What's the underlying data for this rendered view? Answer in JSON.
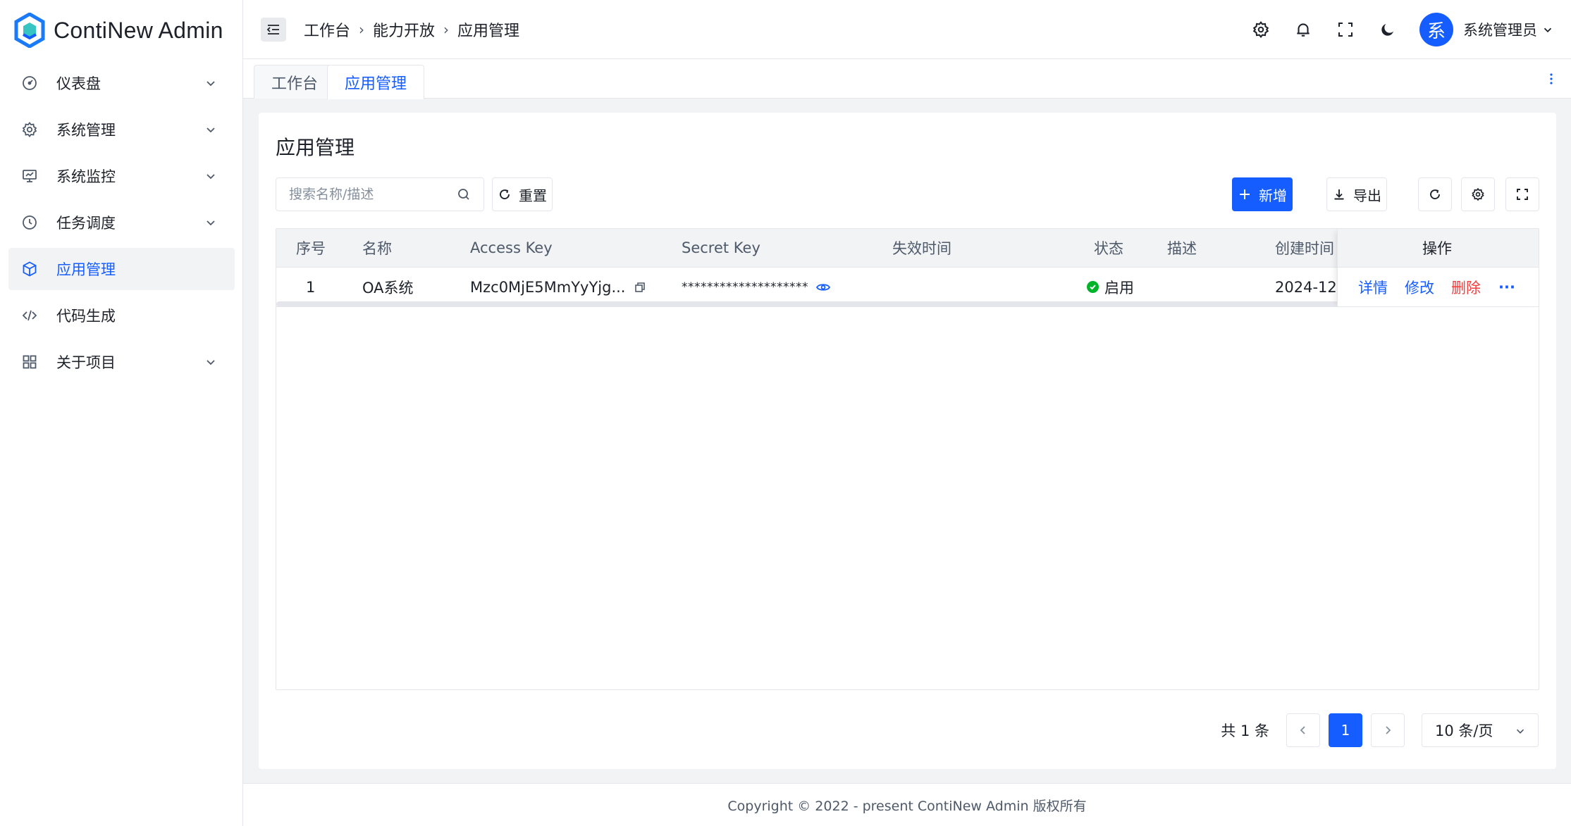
{
  "app": {
    "title": "ContiNew Admin"
  },
  "sidebar": {
    "items": [
      {
        "label": "仪表盘",
        "icon": "dashboard-icon",
        "expandable": true
      },
      {
        "label": "系统管理",
        "icon": "gear-icon",
        "expandable": true
      },
      {
        "label": "系统监控",
        "icon": "monitor-icon",
        "expandable": true
      },
      {
        "label": "任务调度",
        "icon": "clock-icon",
        "expandable": true
      },
      {
        "label": "应用管理",
        "icon": "cube-icon",
        "expandable": false,
        "active": true
      },
      {
        "label": "代码生成",
        "icon": "code-icon",
        "expandable": false
      },
      {
        "label": "关于项目",
        "icon": "grid-icon",
        "expandable": true
      }
    ]
  },
  "header": {
    "breadcrumb": [
      "工作台",
      "能力开放",
      "应用管理"
    ],
    "user": {
      "avatar_text": "系",
      "name": "系统管理员"
    }
  },
  "tabs": [
    {
      "label": "工作台",
      "active": false
    },
    {
      "label": "应用管理",
      "active": true
    }
  ],
  "page": {
    "title": "应用管理",
    "search": {
      "placeholder": "搜索名称/描述",
      "value": ""
    },
    "reset_label": "重置",
    "add_label": "新增",
    "export_label": "导出"
  },
  "table": {
    "columns": [
      "序号",
      "名称",
      "Access Key",
      "Secret Key",
      "失效时间",
      "状态",
      "描述",
      "创建时间",
      "操作"
    ],
    "rows": [
      {
        "index": "1",
        "name": "OA系统",
        "access_key": "Mzc0MjE5MmYyYjg...",
        "secret_key": "********************",
        "expire_time": "",
        "status": "启用",
        "description": "",
        "created_at": "2024-12-",
        "actions": {
          "detail": "详情",
          "edit": "修改",
          "delete": "删除",
          "more": "···"
        }
      }
    ]
  },
  "pagination": {
    "total_text": "共 1 条",
    "current_page": "1",
    "page_size": "10 条/页"
  },
  "footer": {
    "text": "Copyright © 2022 - present ContiNew Admin 版权所有"
  },
  "colors": {
    "primary": "#165dff",
    "danger": "#f53f3f",
    "success": "#00b42a",
    "background": "#f2f3f5"
  }
}
